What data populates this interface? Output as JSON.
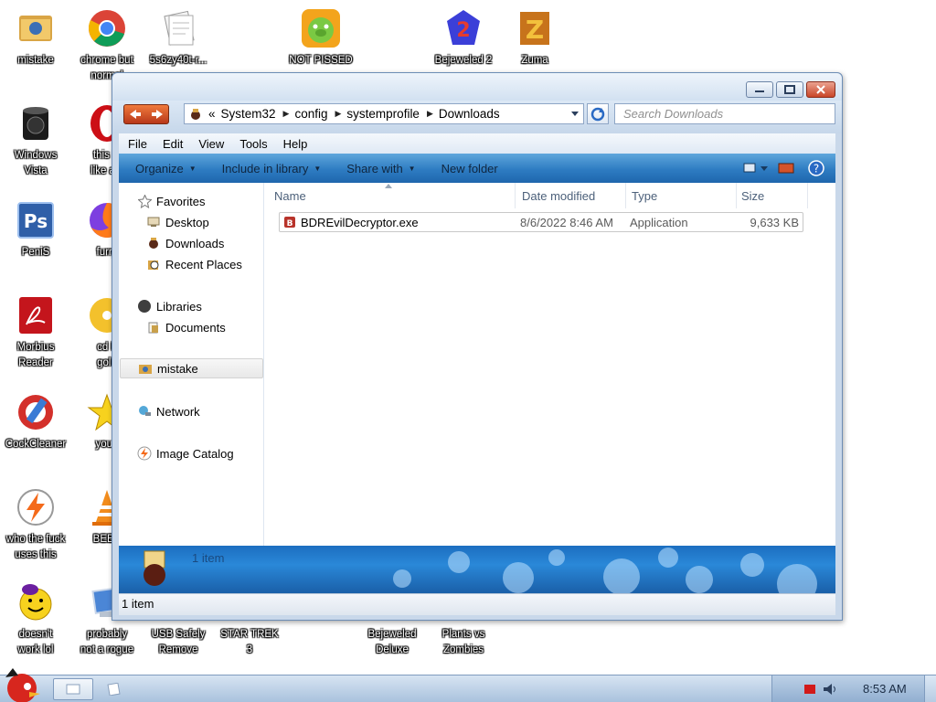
{
  "desktop": {
    "icons": [
      {
        "label": "mistake"
      },
      {
        "label": "chrome but\nnormal"
      },
      {
        "label": "5s6zy40t-r..."
      },
      {
        "label": "NOT PISSED"
      },
      {
        "label": "Bejeweled 2"
      },
      {
        "label": "Zuma"
      },
      {
        "label": "Windows\nVista"
      },
      {
        "label": "this lo\nlike a v"
      },
      {
        "label": "PeniS"
      },
      {
        "label": "furry"
      },
      {
        "label": "Morbius\nReader"
      },
      {
        "label": "cd b\ngold"
      },
      {
        "label": "CockCleaner"
      },
      {
        "label": "you t"
      },
      {
        "label": "who the fuck\nuses this"
      },
      {
        "label": "BEEP"
      },
      {
        "label": "doesn't\nwork lol"
      },
      {
        "label": "probably\nnot a rogue"
      },
      {
        "label": "USB Safely\nRemove"
      },
      {
        "label": "STAR TREK\n3"
      },
      {
        "label": "Bejeweled\nDeluxe"
      },
      {
        "label": "Plants vs\nZombies"
      }
    ]
  },
  "window": {
    "address": {
      "overflow": "«",
      "crumbs": [
        "System32",
        "config",
        "systemprofile",
        "Downloads"
      ]
    },
    "search_placeholder": "Search Downloads",
    "menu": [
      "File",
      "Edit",
      "View",
      "Tools",
      "Help"
    ],
    "commands": [
      "Organize",
      "Include in library",
      "Share with",
      "New folder"
    ],
    "nav": {
      "favorites": "Favorites",
      "desktop": "Desktop",
      "downloads": "Downloads",
      "recent": "Recent Places",
      "libraries": "Libraries",
      "documents": "Documents",
      "user": "mistake",
      "network": "Network",
      "image_catalog": "Image Catalog"
    },
    "columns": {
      "name": "Name",
      "date": "Date modified",
      "type": "Type",
      "size": "Size"
    },
    "files": [
      {
        "name": "BDREvilDecryptor.exe",
        "date": "8/6/2022 8:46 AM",
        "type": "Application",
        "size": "9,633 KB"
      }
    ],
    "details_count": "1 item",
    "status": "1 item"
  },
  "taskbar": {
    "clock": "8:53 AM"
  },
  "colors": {
    "accent": "#2e7cc2",
    "title": "#d2e1f1",
    "close": "#c94528"
  }
}
